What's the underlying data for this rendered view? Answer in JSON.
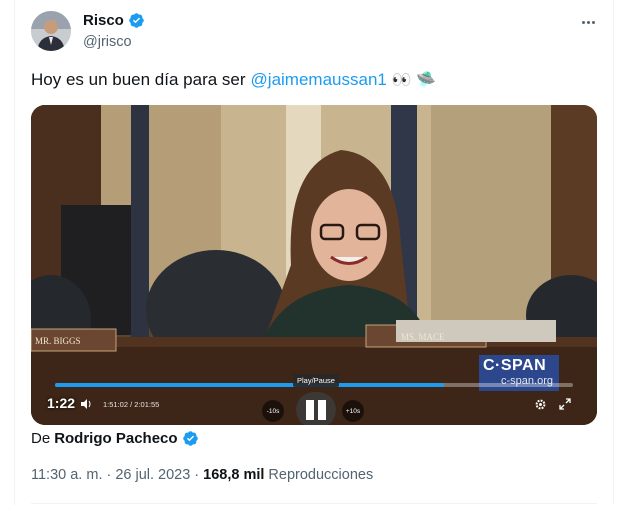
{
  "author": {
    "name": "Risco",
    "handle": "@jrisco",
    "verified": true,
    "avatar_icon": "avatar-photo-icon"
  },
  "tweet": {
    "text": "Hoy es un buen día para ser",
    "mention": "@jaimemaussan1",
    "emojis": "👀 🛸"
  },
  "video": {
    "current_time": "1:22",
    "time_detail": "1:51:02 / 2:01:55",
    "rewind_label": "-10s",
    "forward_label": "+10s",
    "tooltip": "Play/Pause",
    "progress": 0.75,
    "overlay_logo": "C·SPAN",
    "overlay_url": "c-span.org",
    "nameplate_left": "MR. BIGGS",
    "nameplate_center": "MS. MACE"
  },
  "credit": {
    "prefix": "De",
    "name": "Rodrigo Pacheco"
  },
  "meta": {
    "time": "11:30 a. m.",
    "date": "26 jul. 2023",
    "views_count": "168,8 mil",
    "views_label": "Reproducciones",
    "sep": "·"
  },
  "colors": {
    "accent": "#1d9bf0",
    "text": "#0f1419",
    "secondary": "#536471"
  }
}
